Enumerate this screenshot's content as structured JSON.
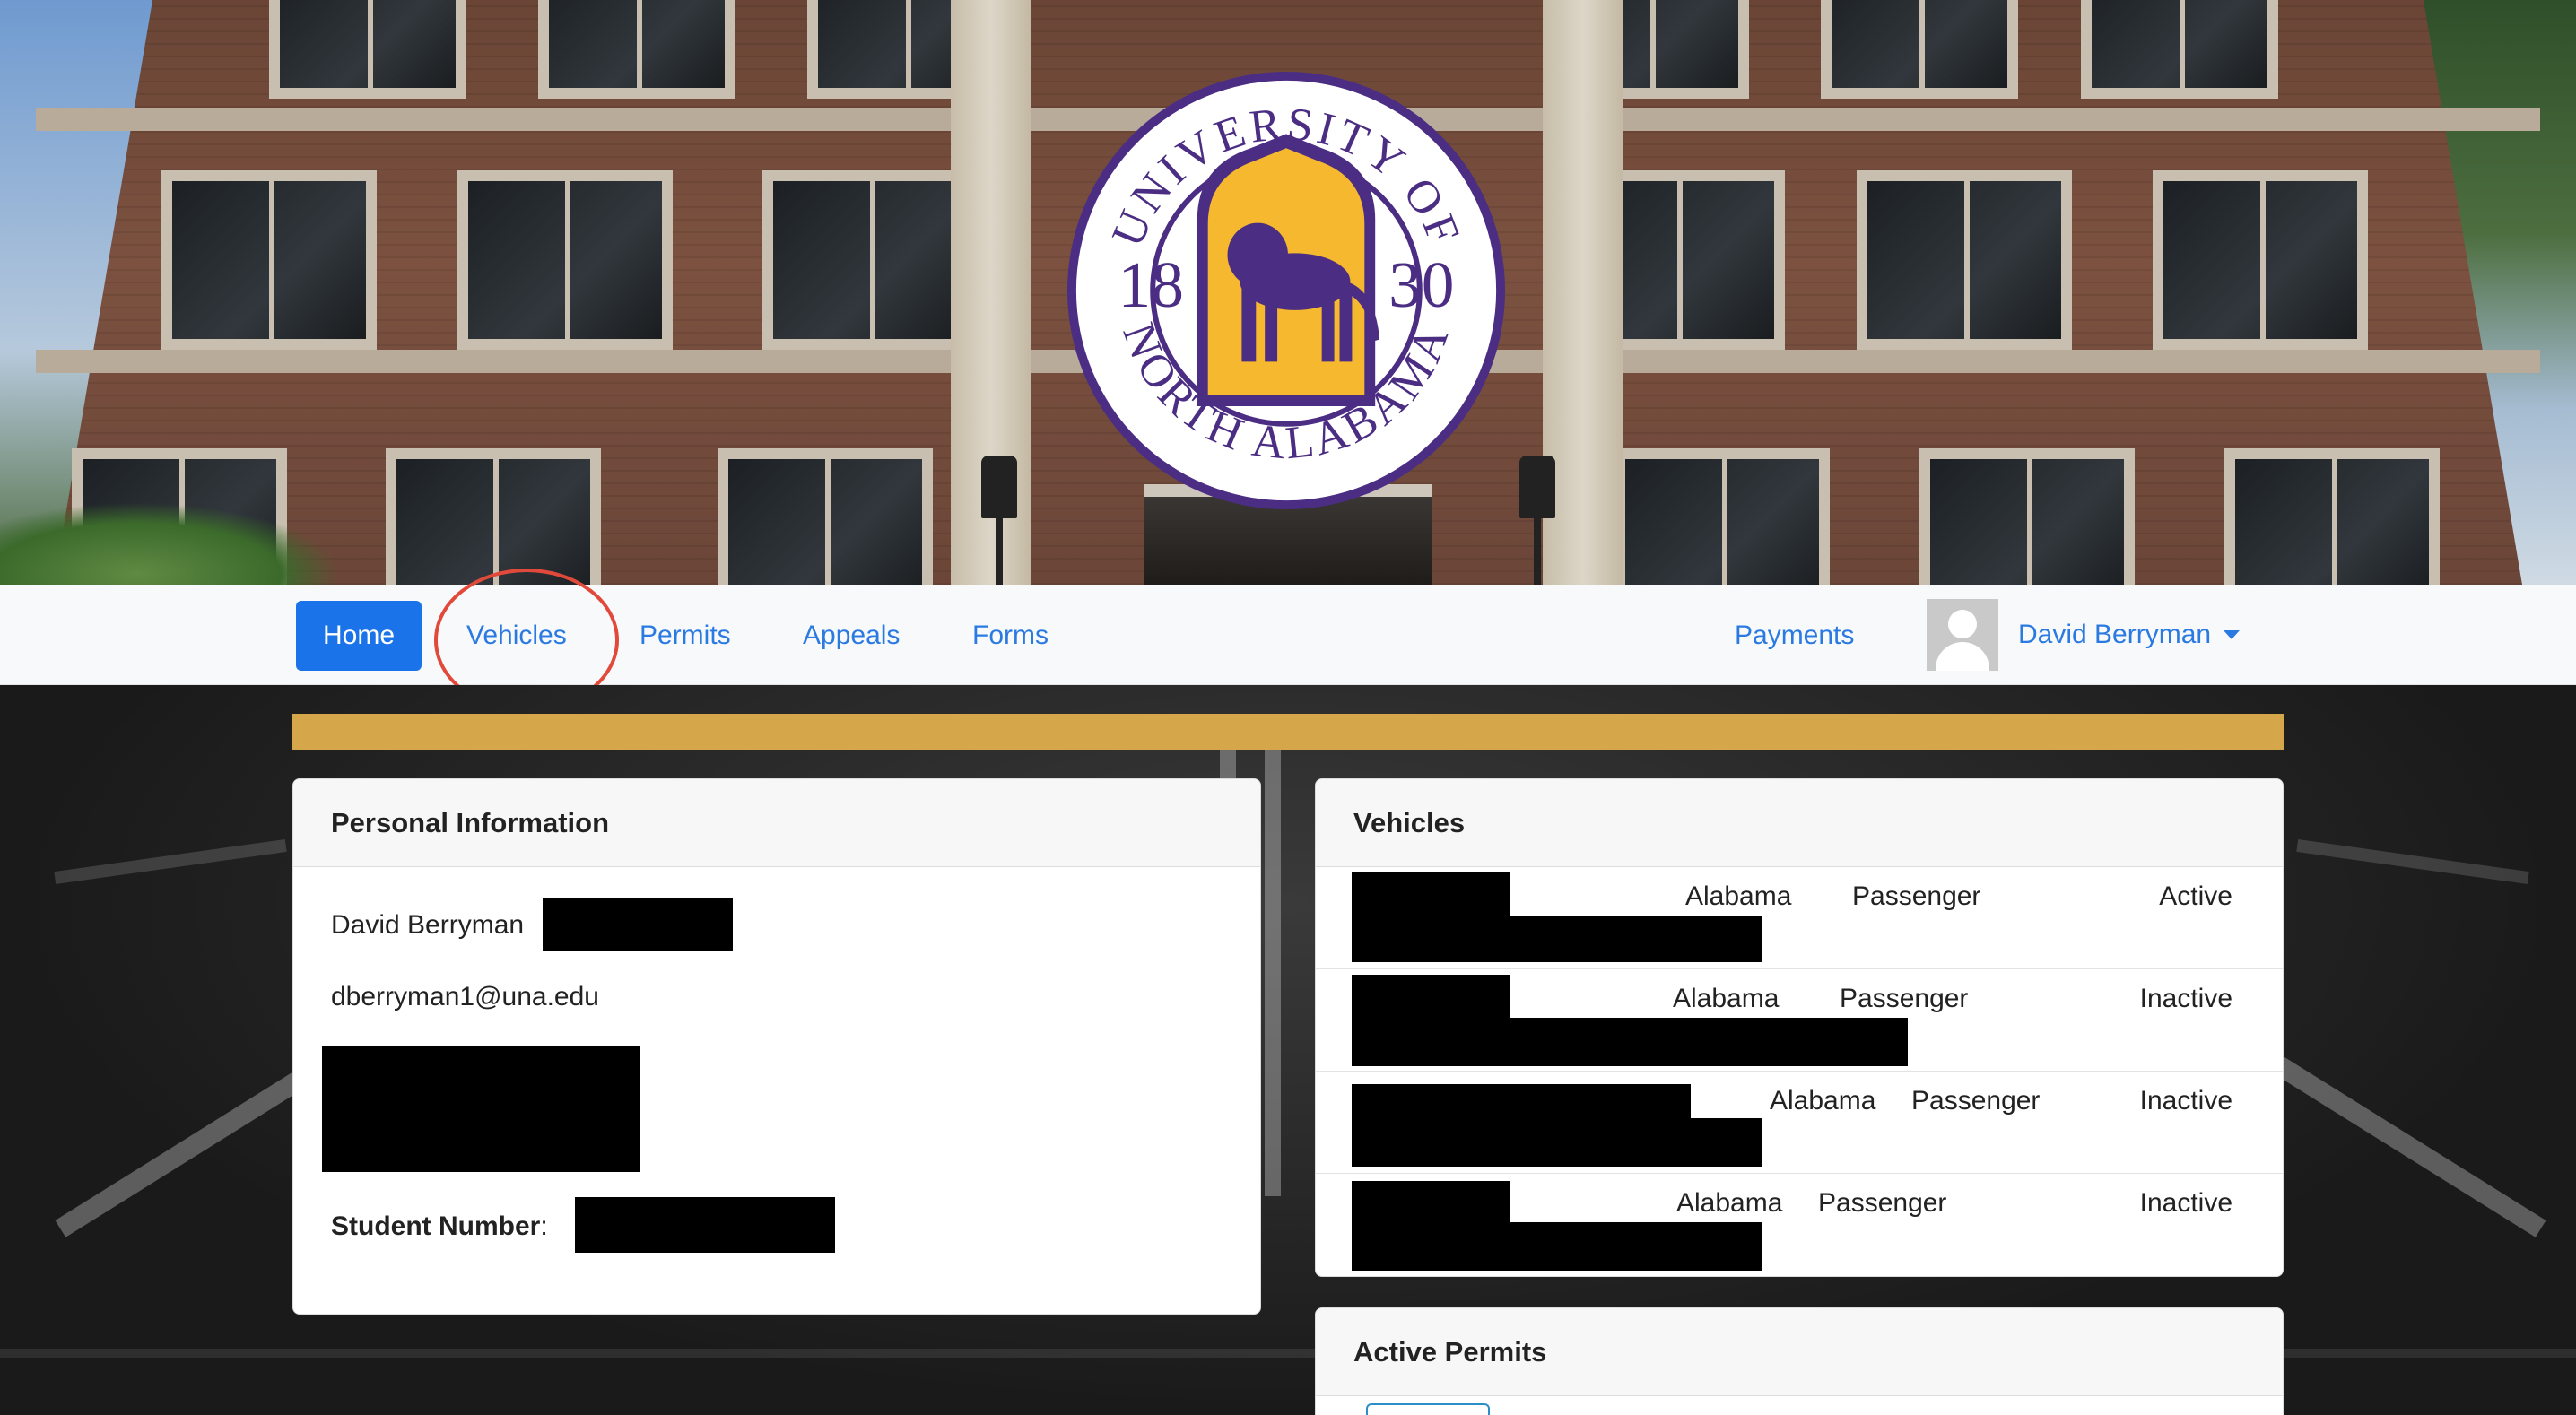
{
  "banner": {
    "seal": {
      "top_text": "UNIVERSITY OF",
      "bottom_text": "NORTH ALABAMA",
      "year_left": "18",
      "year_right": "30",
      "colors": {
        "purple": "#4b2e83",
        "gold": "#f5b82e"
      }
    }
  },
  "navbar": {
    "items": [
      {
        "label": "Home",
        "active": true
      },
      {
        "label": "Vehicles",
        "active": false
      },
      {
        "label": "Permits",
        "active": false
      },
      {
        "label": "Appeals",
        "active": false
      },
      {
        "label": "Forms",
        "active": false
      }
    ],
    "payments_label": "Payments",
    "user_name": "David Berryman"
  },
  "personal_info": {
    "title": "Personal Information",
    "name": "David Berryman",
    "email": "dberryman1@una.edu",
    "student_number_label": "Student Number",
    "student_number_colon": ":"
  },
  "vehicles": {
    "title": "Vehicles",
    "rows": [
      {
        "state": "Alabama",
        "type": "Passenger",
        "status": "Active"
      },
      {
        "state": "Alabama",
        "type": "Passenger",
        "status": "Inactive"
      },
      {
        "state": "Alabama",
        "type": "Passenger",
        "status": "Inactive"
      },
      {
        "state": "Alabama",
        "type": "Passenger",
        "status": "Inactive"
      }
    ]
  },
  "active_permits": {
    "title": "Active Permits"
  },
  "colors": {
    "accent": "#1a73e8",
    "link": "#2a7ae2",
    "gold_bar": "#d5a64a",
    "annotation": "#e14a3b"
  }
}
